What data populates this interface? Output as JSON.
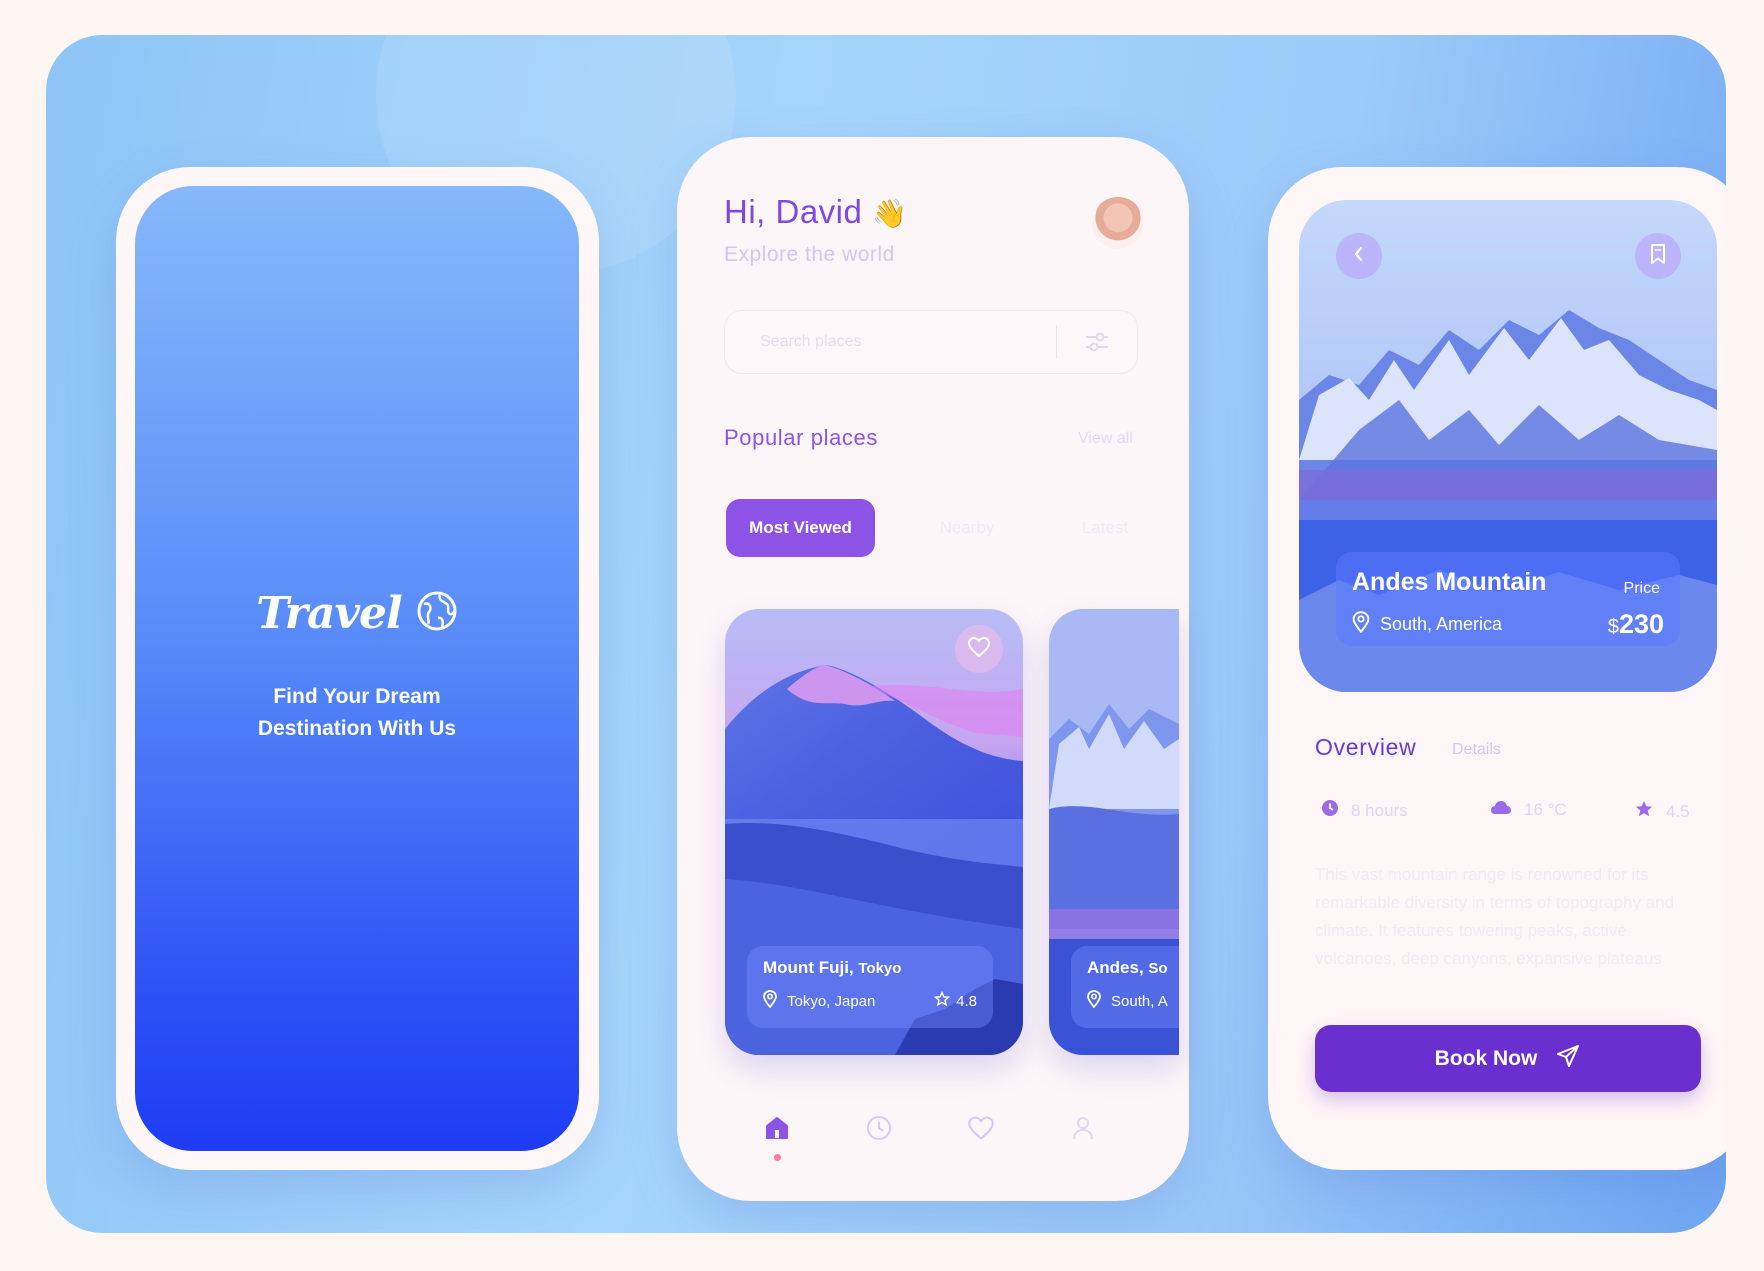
{
  "splash": {
    "logo": "Travel",
    "tagline_line1": "Find Your Dream",
    "tagline_line2": "Destination With Us",
    "icon": "globe-icon"
  },
  "home": {
    "greeting": "Hi, David",
    "wave_emoji": "👋",
    "subtitle": "Explore the world",
    "search": {
      "placeholder": "Search places",
      "icon": "filter-sliders-icon"
    },
    "section_title": "Popular places",
    "view_all": "View all",
    "filters": [
      {
        "label": "Most Viewed",
        "active": true
      },
      {
        "label": "Nearby",
        "active": false
      },
      {
        "label": "Latest",
        "active": false
      }
    ],
    "cards": [
      {
        "name": "Mount Fuji,",
        "city": "Tokyo",
        "location": "Tokyo, Japan",
        "rating": "4.8"
      },
      {
        "name": "Andes,",
        "city": "So",
        "location": "South, A"
      }
    ],
    "nav": [
      "home-icon",
      "clock-icon",
      "heart-icon",
      "profile-icon"
    ],
    "active_nav": "home-icon"
  },
  "detail": {
    "title": "Andes Mountain",
    "price_label": "Price",
    "location": "South, America",
    "currency": "$",
    "price": "230",
    "tabs": {
      "overview": "Overview",
      "details": "Details"
    },
    "stats": [
      {
        "icon": "clock-icon",
        "value": "8 hours"
      },
      {
        "icon": "cloud-icon",
        "value": "16 °C"
      },
      {
        "icon": "star-icon",
        "value": "4.5"
      }
    ],
    "description": "This vast mountain range is renowned for its remarkable diversity in terms of topography and climate. It features towering peaks, active volcanoes, deep canyons, expansive plateaus",
    "book_label": "Book Now"
  },
  "colors": {
    "accent": "#8d52e6",
    "button": "#6a2fcf",
    "splash_top": "#86b8fb",
    "splash_bottom": "#1f3cf3"
  }
}
